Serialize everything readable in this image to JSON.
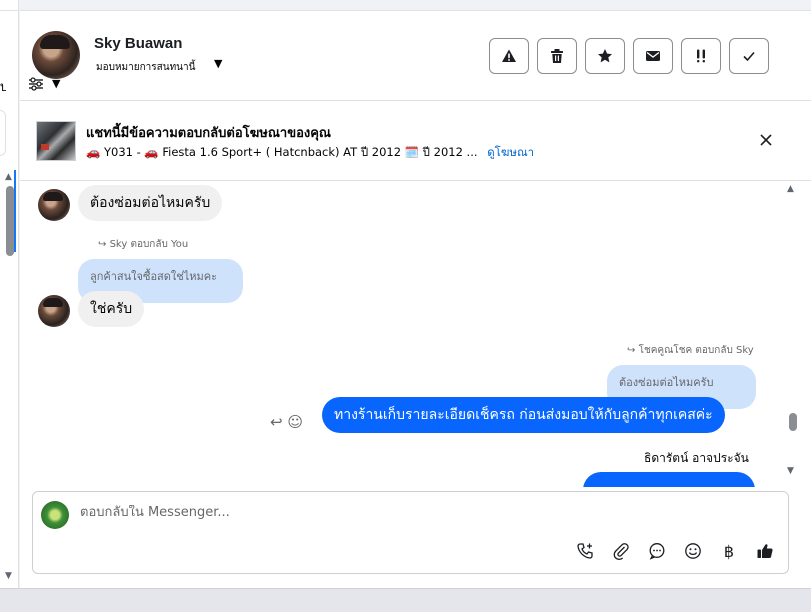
{
  "sidebar": {
    "clipped_text": "บ"
  },
  "header": {
    "contact_name": "Sky Buawan",
    "assign_label": "มอบหมายการสนทนานี้",
    "actions": [
      {
        "name": "report-button",
        "icon": "warning-icon"
      },
      {
        "name": "delete-button",
        "icon": "trash-icon"
      },
      {
        "name": "star-button",
        "icon": "star-icon"
      },
      {
        "name": "mark-unread-button",
        "icon": "envelope-icon"
      },
      {
        "name": "follow-up-button",
        "icon": "double-exclamation-icon"
      },
      {
        "name": "mark-done-button",
        "icon": "check-icon"
      }
    ]
  },
  "ad_banner": {
    "title": "แชทนี้มีข้อความตอบกลับต่อโฆษณาของคุณ",
    "details": "🚗 Y031 - 🚗 Fiesta 1.6 Sport+ ( Hatcnback) AT ปี 2012 🗓️ ปี 2012 ...",
    "view_ad_link": "ดูโฆษณา"
  },
  "messages": {
    "m1_text": "ต้องซ่อมต่อไหมครับ",
    "reply1_meta": "Sky ตอบกลับ You",
    "reply1_quote": "ลูกค้าสนใจซื้อสดใช่ไหมคะ",
    "m2_text": "ใช่ครับ",
    "reply2_meta": "โชคคูณโชค ตอบกลับ Sky",
    "reply2_quote": "ต้องซ่อมต่อไหมครับ",
    "m3_text": "ทางร้านเก็บรายละเอียดเช็ครถ ก่อนส่งมอบให้กับลูกค้าทุกเคสค่ะ",
    "next_sender": "ธิดารัตน์ อาจประจัน"
  },
  "composer": {
    "placeholder": "ตอบกลับใน Messenger...",
    "tools": [
      "call-plus-icon",
      "attachment-icon",
      "chat-bubble-icon",
      "emoji-icon",
      "baht-icon",
      "thumbs-up-icon"
    ]
  }
}
